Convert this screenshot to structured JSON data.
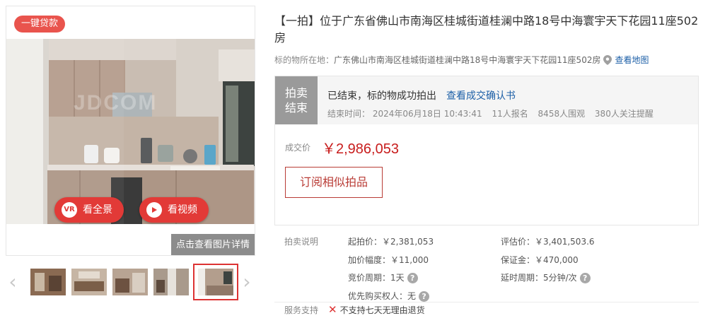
{
  "gallery": {
    "badge": "一键贷款",
    "vr_button": "看全景",
    "vr_icon_text": "VR",
    "video_button": "看视频",
    "detail_link": "点击查看图片详情",
    "watermark": "JDCOM",
    "thumbnails": [
      "thumb-1",
      "thumb-2",
      "thumb-3",
      "thumb-4",
      "thumb-5"
    ],
    "active_thumbnail": 5
  },
  "listing": {
    "title": "【一拍】位于广东省佛山市南海区桂城街道桂澜中路18号中海寰宇天下花园11座502房",
    "location_label": "标的物所在地：",
    "location_address": "广东佛山市南海区桂城街道桂澜中路18号中海寰宇天下花园11座502房",
    "map_link": "查看地图"
  },
  "status": {
    "tag_line1": "拍卖",
    "tag_line2": "结束",
    "text": "已结束，标的物成功拍出",
    "confirm_link": "查看成交确认书",
    "end_time": "结束时间： 2024年06月18日 10:43:41",
    "signups": "11人报名",
    "views": "8458人围观",
    "reminders": "380人关注提醒"
  },
  "deal": {
    "price_label": "成交价",
    "price_value": "￥2,986,053",
    "subscribe_button": "订阅相似拍品"
  },
  "specs": {
    "section_label": "拍卖说明",
    "start_price": "起拍价：￥2,381,053",
    "appraisal": "评估价：￥3,401,503.6",
    "increment": "加价幅度：￥11,000",
    "deposit": "保证金：￥470,000",
    "bid_period": "竞价周期：1天",
    "delay_period": "延时周期：5分钟/次",
    "priority_buyer": "优先购买权人：无"
  },
  "service": {
    "label": "服务支持",
    "item": "不支持七天无理由退货"
  },
  "colors": {
    "accent_red": "#c81d1d",
    "badge_red": "#e9544d",
    "link_blue": "#1c5fa7",
    "status_gray": "#9a9a9a"
  }
}
